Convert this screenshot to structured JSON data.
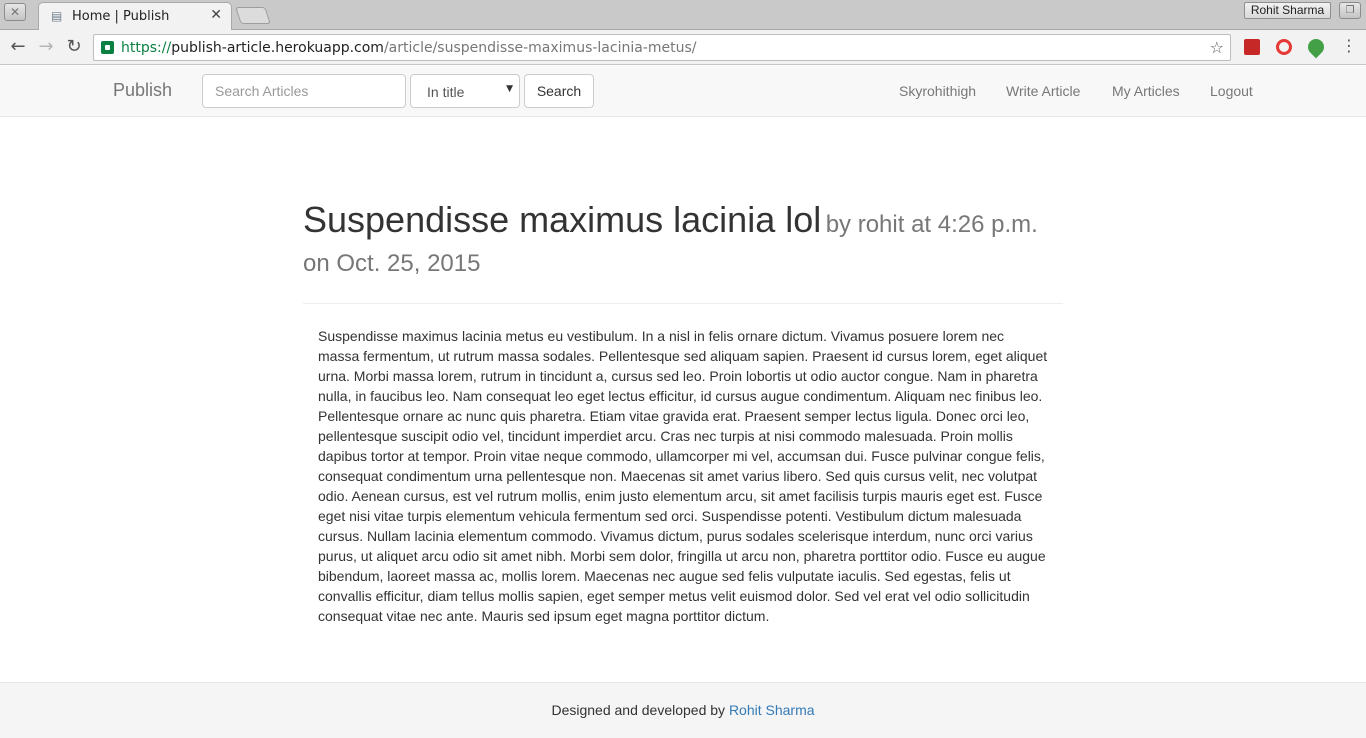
{
  "browser": {
    "tab_title": "Home | Publish",
    "user_name": "Rohit Sharma",
    "url_scheme": "https://",
    "url_host": "publish-article.herokuapp.com",
    "url_path": "/article/suspendisse-maximus-lacinia-metus/",
    "extension_icons": [
      "book-icon",
      "opera-icon",
      "leaf-icon"
    ]
  },
  "navbar": {
    "brand": "Publish",
    "search_placeholder": "Search Articles",
    "search_scope_selected": "In title",
    "search_button": "Search",
    "links": [
      "Skyrohithigh",
      "Write Article",
      "My Articles",
      "Logout"
    ]
  },
  "article": {
    "title": "Suspendisse maximus lacinia lol",
    "byline": "by rohit at 4:26 p.m. on Oct. 25, 2015",
    "body": "Suspendisse maximus lacinia metus eu vestibulum. In a nisl in felis ornare dictum. Vivamus posuere lorem nec massa fermentum, ut rutrum massa sodales. Pellentesque sed aliquam sapien. Praesent id cursus lorem, eget aliquet urna. Morbi massa lorem, rutrum in tincidunt a, cursus sed leo. Proin lobortis ut odio auctor congue. Nam in pharetra nulla, in faucibus leo. Nam consequat leo eget lectus efficitur, id cursus augue condimentum. Aliquam nec finibus leo. Pellentesque ornare ac nunc quis pharetra. Etiam vitae gravida erat. Praesent semper lectus ligula. Donec orci leo, pellentesque suscipit odio vel, tincidunt imperdiet arcu. Cras nec turpis at nisi commodo malesuada. Proin mollis dapibus tortor at tempor. Proin vitae neque commodo, ullamcorper mi vel, accumsan dui. Fusce pulvinar congue felis, consequat condimentum urna pellentesque non. Maecenas sit amet varius libero. Sed quis cursus velit, nec volutpat odio. Aenean cursus, est vel rutrum mollis, enim justo elementum arcu, sit amet facilisis turpis mauris eget est. Fusce eget nisi vitae turpis elementum vehicula fermentum sed orci. Suspendisse potenti. Vestibulum dictum malesuada cursus. Nullam lacinia elementum commodo. Vivamus dictum, purus sodales scelerisque interdum, nunc orci varius purus, ut aliquet arcu odio sit amet nibh. Morbi sem dolor, fringilla ut arcu non, pharetra porttitor odio. Fusce eu augue bibendum, laoreet massa ac, mollis lorem. Maecenas nec augue sed felis vulputate iaculis. Sed egestas, felis ut convallis efficitur, diam tellus mollis sapien, eget semper metus velit euismod dolor. Sed vel erat vel odio sollicitudin consequat vitae nec ante. Mauris sed ipsum eget magna porttitor dictum."
  },
  "footer": {
    "text": "Designed and developed by",
    "link": "Rohit Sharma"
  },
  "colors": {
    "link": "#337ab7",
    "secure": "#0b8043"
  }
}
